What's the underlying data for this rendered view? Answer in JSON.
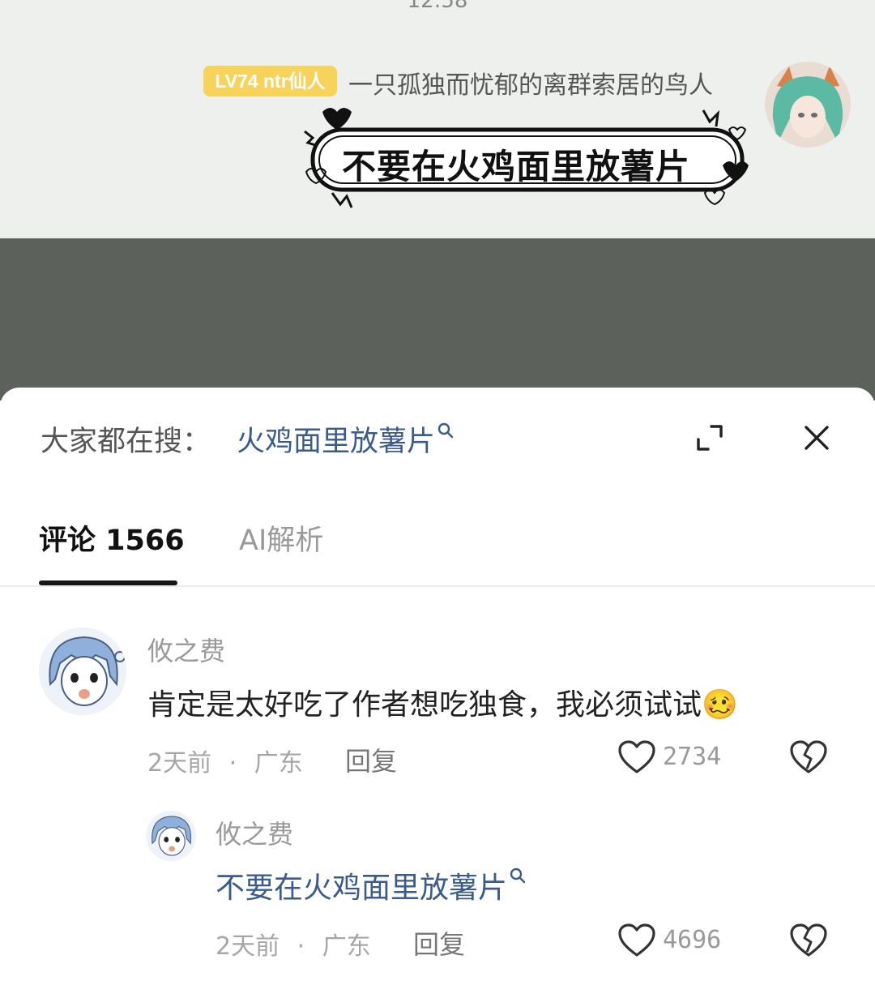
{
  "status": {
    "time": "12:58"
  },
  "chat": {
    "level_badge": "LV74 ntr仙人",
    "sender_name": "一只孤独而忧郁的离群索居的鸟人",
    "sticker_text": "不要在火鸡面里放薯片"
  },
  "search": {
    "prefix": "大家都在搜：",
    "query": "火鸡面里放薯片"
  },
  "tabs": [
    {
      "label": "评论 1566",
      "active": true
    },
    {
      "label": "AI解析",
      "active": false
    }
  ],
  "comments": [
    {
      "user": "攸之费",
      "text": "肯定是太好吃了作者想吃独食，我必须试试",
      "emoji": "🥴",
      "time": "2天前",
      "location": "广东",
      "reply_label": "回复",
      "likes": "2734"
    },
    {
      "user": "攸之费",
      "text": "不要在火鸡面里放薯片",
      "time": "2天前",
      "location": "广东",
      "reply_label": "回复",
      "likes": "4696"
    }
  ],
  "meta_separator": "·",
  "colors": {
    "badge": "#f7d35c",
    "link": "#3b5a8d",
    "overlay": "#5d615c",
    "chat_bg": "#eef0ee"
  }
}
